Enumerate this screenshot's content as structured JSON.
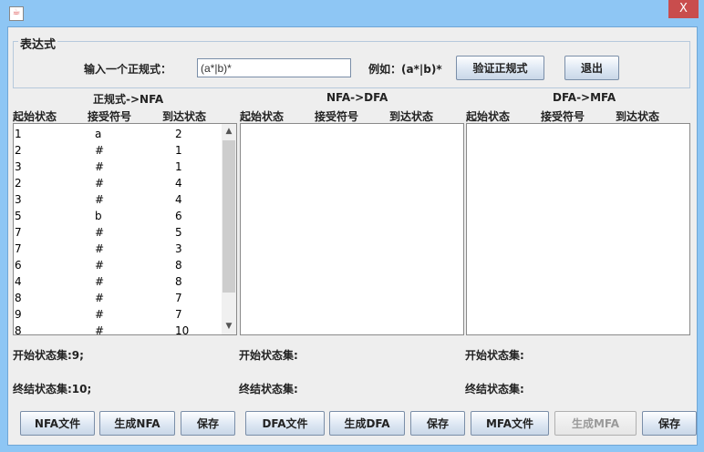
{
  "window": {
    "close": "X"
  },
  "expr_group": {
    "title": "表达式",
    "input_label": "输入一个正规式：",
    "input_value": "(a*|b)*",
    "example": "例如：(a*|b)*",
    "verify_button": "验证正规式",
    "exit_button": "退出"
  },
  "columns": [
    "起始状态",
    "接受符号",
    "到达状态"
  ],
  "panels": [
    {
      "title": "正规式->NFA",
      "start_set": "开始状态集:9;",
      "end_set": "终结状态集:10;",
      "buttons": [
        "NFA文件",
        "生成NFA",
        "保存"
      ],
      "rows": [
        [
          "1",
          "a",
          "2"
        ],
        [
          "2",
          "#",
          "1"
        ],
        [
          "3",
          "#",
          "1"
        ],
        [
          "2",
          "#",
          "4"
        ],
        [
          "3",
          "#",
          "4"
        ],
        [
          "5",
          "b",
          "6"
        ],
        [
          "7",
          "#",
          "5"
        ],
        [
          "7",
          "#",
          "3"
        ],
        [
          "6",
          "#",
          "8"
        ],
        [
          "4",
          "#",
          "8"
        ],
        [
          "8",
          "#",
          "7"
        ],
        [
          "9",
          "#",
          "7"
        ],
        [
          "8",
          "#",
          "10"
        ]
      ]
    },
    {
      "title": "NFA->DFA",
      "start_set": "开始状态集:",
      "end_set": "终结状态集:",
      "buttons": [
        "DFA文件",
        "生成DFA",
        "保存"
      ],
      "rows": []
    },
    {
      "title": "DFA->MFA",
      "start_set": "开始状态集:",
      "end_set": "终结状态集:",
      "buttons": [
        "MFA文件",
        "生成MFA",
        "保存"
      ],
      "rows": []
    }
  ]
}
